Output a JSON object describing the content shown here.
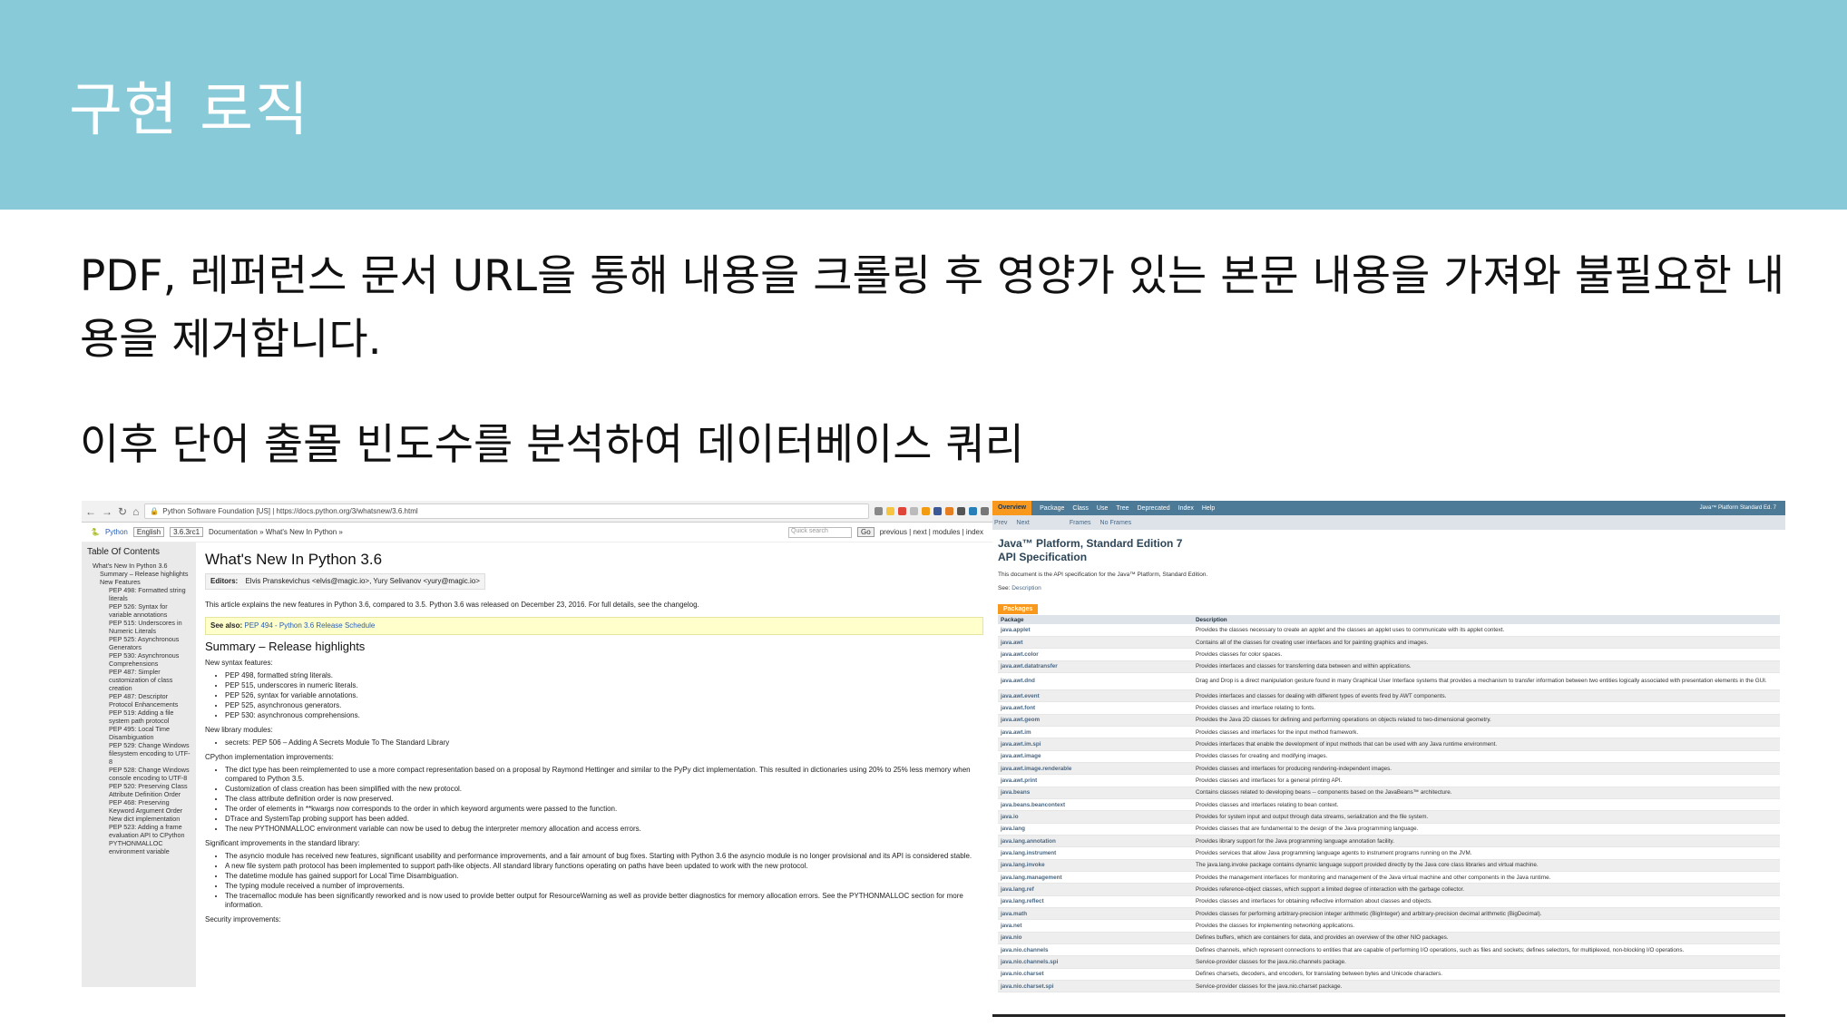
{
  "slide": {
    "title": "구현 로직",
    "paragraph1": "PDF, 레퍼런스 문서 URL을 통해 내용을 크롤링 후 영양가 있는 본문 내용을 가져와 불필요한 내용을 제거합니다.",
    "paragraph2": "이후 단어 출몰 빈도수를 분석하여 데이터베이스 쿼리"
  },
  "left_screenshot": {
    "browser": {
      "site_label": "Python Software Foundation [US]",
      "url": "https://docs.python.org/3/whatsnew/3.6.html"
    },
    "topbar": {
      "python": "Python",
      "lang": "English",
      "version": "3.6.3rc1",
      "crumbs": "Documentation » What's New In Python »",
      "quick_search": "Quick search",
      "go": "Go",
      "nav_links": "previous | next | modules | index"
    },
    "toc": {
      "heading": "Table Of Contents",
      "items": [
        {
          "level": 1,
          "text": "What's New In Python 3.6"
        },
        {
          "level": 2,
          "text": "Summary – Release highlights"
        },
        {
          "level": 2,
          "text": "New Features"
        },
        {
          "level": 3,
          "text": "PEP 498: Formatted string literals"
        },
        {
          "level": 3,
          "text": "PEP 526: Syntax for variable annotations"
        },
        {
          "level": 3,
          "text": "PEP 515: Underscores in Numeric Literals"
        },
        {
          "level": 3,
          "text": "PEP 525: Asynchronous Generators"
        },
        {
          "level": 3,
          "text": "PEP 530: Asynchronous Comprehensions"
        },
        {
          "level": 3,
          "text": "PEP 487: Simpler customization of class creation"
        },
        {
          "level": 3,
          "text": "PEP 487: Descriptor Protocol Enhancements"
        },
        {
          "level": 3,
          "text": "PEP 519: Adding a file system path protocol"
        },
        {
          "level": 3,
          "text": "PEP 495: Local Time Disambiguation"
        },
        {
          "level": 3,
          "text": "PEP 529: Change Windows filesystem encoding to UTF-8"
        },
        {
          "level": 3,
          "text": "PEP 528: Change Windows console encoding to UTF-8"
        },
        {
          "level": 3,
          "text": "PEP 520: Preserving Class Attribute Definition Order"
        },
        {
          "level": 3,
          "text": "PEP 468: Preserving Keyword Argument Order"
        },
        {
          "level": 3,
          "text": "New dict implementation"
        },
        {
          "level": 3,
          "text": "PEP 523: Adding a frame evaluation API to CPython"
        },
        {
          "level": 3,
          "text": "PYTHONMALLOC environment variable"
        }
      ]
    },
    "doc": {
      "title": "What's New In Python 3.6",
      "editors_label": "Editors:",
      "editors": "Elvis Pranskevichus <elvis@magic.io>, Yury Selivanov <yury@magic.io>",
      "intro": "This article explains the new features in Python 3.6, compared to 3.5. Python 3.6 was released on December 23, 2016. For full details, see the changelog.",
      "see_also_label": "See also:",
      "see_also": "PEP 494 - Python 3.6 Release Schedule",
      "summary_heading": "Summary – Release highlights",
      "syntax_label": "New syntax features:",
      "syntax_items": [
        "PEP 498, formatted string literals.",
        "PEP 515, underscores in numeric literals.",
        "PEP 526, syntax for variable annotations.",
        "PEP 525, asynchronous generators.",
        "PEP 530: asynchronous comprehensions."
      ],
      "library_label": "New library modules:",
      "library_items": [
        "secrets: PEP 506 – Adding A Secrets Module To The Standard Library"
      ],
      "cpython_label": "CPython implementation improvements:",
      "cpython_items": [
        "The dict type has been reimplemented to use a more compact representation based on a proposal by Raymond Hettinger and similar to the PyPy dict implementation. This resulted in dictionaries using 20% to 25% less memory when compared to Python 3.5.",
        "Customization of class creation has been simplified with the new protocol.",
        "The class attribute definition order is now preserved.",
        "The order of elements in **kwargs now corresponds to the order in which keyword arguments were passed to the function.",
        "DTrace and SystemTap probing support has been added.",
        "The new PYTHONMALLOC environment variable can now be used to debug the interpreter memory allocation and access errors."
      ],
      "stdlib_label": "Significant improvements in the standard library:",
      "stdlib_items": [
        "The asyncio module has received new features, significant usability and performance improvements, and a fair amount of bug fixes. Starting with Python 3.6 the asyncio module is no longer provisional and its API is considered stable.",
        "A new file system path protocol has been implemented to support path-like objects. All standard library functions operating on paths have been updated to work with the new protocol.",
        "The datetime module has gained support for Local Time Disambiguation.",
        "The typing module received a number of improvements.",
        "The tracemalloc module has been significantly reworked and is now used to provide better output for ResourceWarning as well as provide better diagnostics for memory allocation errors. See the PYTHONMALLOC section for more information."
      ],
      "security_label": "Security improvements:"
    }
  },
  "right_screenshot": {
    "nav": [
      "Overview",
      "Package",
      "Class",
      "Use",
      "Tree",
      "Deprecated",
      "Index",
      "Help"
    ],
    "brand": "Java™ Platform Standard Ed. 7",
    "subnav": [
      "Prev",
      "Next",
      "Frames",
      "No Frames"
    ],
    "title_line1": "Java™ Platform, Standard Edition 7",
    "title_line2": "API Specification",
    "intro": "This document is the API specification for the Java™ Platform, Standard Edition.",
    "see_label": "See:",
    "see_link": "Description",
    "tab": "Packages",
    "col_package": "Package",
    "col_description": "Description",
    "packages": [
      {
        "name": "java.applet",
        "desc": "Provides the classes necessary to create an applet and the classes an applet uses to communicate with its applet context."
      },
      {
        "name": "java.awt",
        "desc": "Contains all of the classes for creating user interfaces and for painting graphics and images."
      },
      {
        "name": "java.awt.color",
        "desc": "Provides classes for color spaces."
      },
      {
        "name": "java.awt.datatransfer",
        "desc": "Provides interfaces and classes for transferring data between and within applications."
      },
      {
        "name": "java.awt.dnd",
        "desc": "Drag and Drop is a direct manipulation gesture found in many Graphical User Interface systems that provides a mechanism to transfer information between two entities logically associated with presentation elements in the GUI.",
        "tall": true
      },
      {
        "name": "java.awt.event",
        "desc": "Provides interfaces and classes for dealing with different types of events fired by AWT components."
      },
      {
        "name": "java.awt.font",
        "desc": "Provides classes and interface relating to fonts."
      },
      {
        "name": "java.awt.geom",
        "desc": "Provides the Java 2D classes for defining and performing operations on objects related to two-dimensional geometry."
      },
      {
        "name": "java.awt.im",
        "desc": "Provides classes and interfaces for the input method framework."
      },
      {
        "name": "java.awt.im.spi",
        "desc": "Provides interfaces that enable the development of input methods that can be used with any Java runtime environment."
      },
      {
        "name": "java.awt.image",
        "desc": "Provides classes for creating and modifying images."
      },
      {
        "name": "java.awt.image.renderable",
        "desc": "Provides classes and interfaces for producing rendering-independent images."
      },
      {
        "name": "java.awt.print",
        "desc": "Provides classes and interfaces for a general printing API."
      },
      {
        "name": "java.beans",
        "desc": "Contains classes related to developing beans -- components based on the JavaBeans™ architecture."
      },
      {
        "name": "java.beans.beancontext",
        "desc": "Provides classes and interfaces relating to bean context."
      },
      {
        "name": "java.io",
        "desc": "Provides for system input and output through data streams, serialization and the file system."
      },
      {
        "name": "java.lang",
        "desc": "Provides classes that are fundamental to the design of the Java programming language."
      },
      {
        "name": "java.lang.annotation",
        "desc": "Provides library support for the Java programming language annotation facility."
      },
      {
        "name": "java.lang.instrument",
        "desc": "Provides services that allow Java programming language agents to instrument programs running on the JVM."
      },
      {
        "name": "java.lang.invoke",
        "desc": "The java.lang.invoke package contains dynamic language support provided directly by the Java core class libraries and virtual machine."
      },
      {
        "name": "java.lang.management",
        "desc": "Provides the management interfaces for monitoring and management of the Java virtual machine and other components in the Java runtime."
      },
      {
        "name": "java.lang.ref",
        "desc": "Provides reference-object classes, which support a limited degree of interaction with the garbage collector."
      },
      {
        "name": "java.lang.reflect",
        "desc": "Provides classes and interfaces for obtaining reflective information about classes and objects."
      },
      {
        "name": "java.math",
        "desc": "Provides classes for performing arbitrary-precision integer arithmetic (BigInteger) and arbitrary-precision decimal arithmetic (BigDecimal)."
      },
      {
        "name": "java.net",
        "desc": "Provides the classes for implementing networking applications."
      },
      {
        "name": "java.nio",
        "desc": "Defines buffers, which are containers for data, and provides an overview of the other NIO packages."
      },
      {
        "name": "java.nio.channels",
        "desc": "Defines channels, which represent connections to entities that are capable of performing I/O operations, such as files and sockets; defines selectors, for multiplexed, non-blocking I/O operations."
      },
      {
        "name": "java.nio.channels.spi",
        "desc": "Service-provider classes for the java.nio.channels package."
      },
      {
        "name": "java.nio.charset",
        "desc": "Defines charsets, decoders, and encoders, for translating between bytes and Unicode characters."
      },
      {
        "name": "java.nio.charset.spi",
        "desc": "Service-provider classes for the java.nio.charset package."
      }
    ]
  }
}
